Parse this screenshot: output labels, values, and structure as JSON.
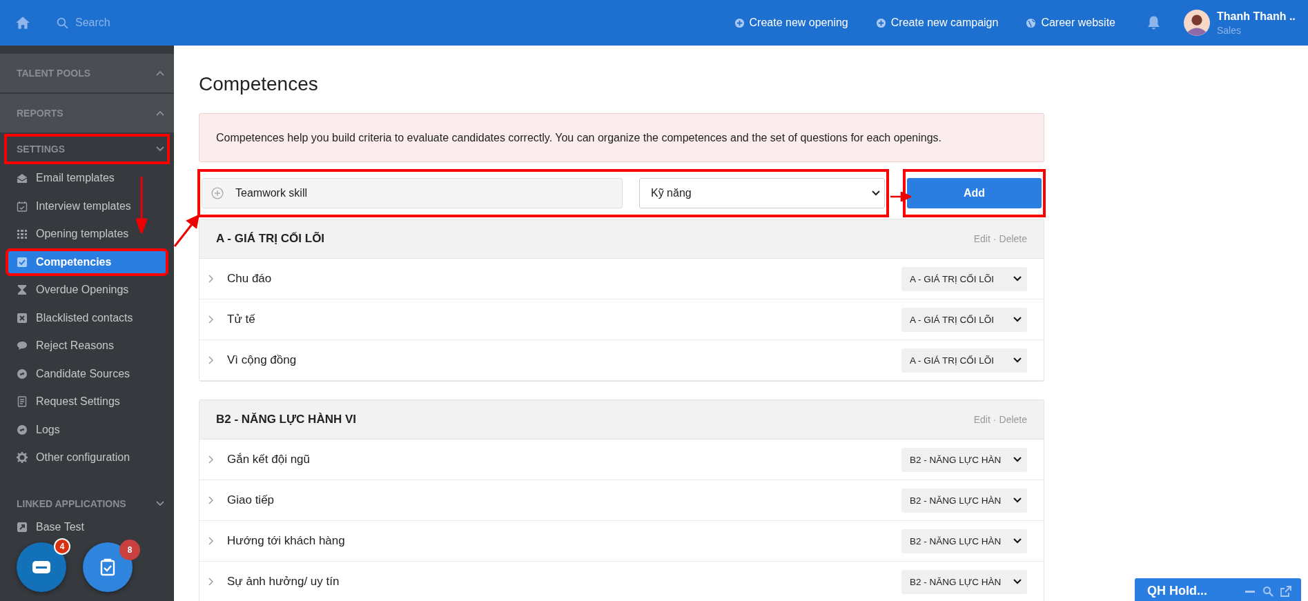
{
  "topbar": {
    "search_placeholder": "Search",
    "actions": [
      "Create new opening",
      "Create new campaign",
      "Career website"
    ],
    "user": {
      "name": "Thanh Thanh ..",
      "role": "Sales"
    }
  },
  "sidebar": {
    "sections": [
      {
        "title": "TALENT POOLS",
        "expanded": false,
        "highlighted": false
      },
      {
        "title": "REPORTS",
        "expanded": false,
        "highlighted": false
      },
      {
        "title": "SETTINGS",
        "expanded": true,
        "highlighted": true,
        "items": [
          {
            "label": "Email templates",
            "selected": false,
            "highlighted": false
          },
          {
            "label": "Interview templates",
            "selected": false,
            "highlighted": false
          },
          {
            "label": "Opening templates",
            "selected": false,
            "highlighted": false
          },
          {
            "label": "Competencies",
            "selected": true,
            "highlighted": true
          },
          {
            "label": "Overdue Openings",
            "selected": false,
            "highlighted": false
          },
          {
            "label": "Blacklisted contacts",
            "selected": false,
            "highlighted": false
          },
          {
            "label": "Reject Reasons",
            "selected": false,
            "highlighted": false
          },
          {
            "label": "Candidate Sources",
            "selected": false,
            "highlighted": false
          },
          {
            "label": "Request Settings",
            "selected": false,
            "highlighted": false
          },
          {
            "label": "Logs",
            "selected": false,
            "highlighted": false
          },
          {
            "label": "Other configuration",
            "selected": false,
            "highlighted": false
          }
        ]
      },
      {
        "title": "LINKED APPLICATIONS",
        "expanded": true,
        "highlighted": false,
        "items": [
          {
            "label": "Base Test",
            "selected": false,
            "highlighted": false
          }
        ]
      }
    ]
  },
  "page": {
    "title": "Competences",
    "notice": "Competences help you build criteria to evaluate candidates correctly. You can organize the competences and the set of questions for each openings.",
    "form": {
      "value": "Teamwork skill",
      "category": "Kỹ năng",
      "highlighted": true,
      "add_label": "Add",
      "add_highlighted": true
    },
    "groups": [
      {
        "title": "A - GIÁ TRỊ CỐI LÕI",
        "edit": "Edit",
        "separator": "·",
        "delete": "Delete",
        "items": [
          {
            "name": "Chu đáo",
            "category": "A - GIÁ TRỊ CỐI LÕI"
          },
          {
            "name": "Tử tế",
            "category": "A - GIÁ TRỊ CỐI LÕI"
          },
          {
            "name": "Vì cộng đồng",
            "category": "A - GIÁ TRỊ CỐI LÕI"
          }
        ]
      },
      {
        "title": "B2 - NĂNG LỰC HÀNH VI",
        "edit": "Edit",
        "separator": "·",
        "delete": "Delete",
        "items": [
          {
            "name": "Gắn kết đội ngũ",
            "category": "B2 - NĂNG LỰC HÀN"
          },
          {
            "name": "Giao tiếp",
            "category": "B2 - NĂNG LỰC HÀN"
          },
          {
            "name": "Hướng tới khách hàng",
            "category": "B2 - NĂNG LỰC HÀN"
          },
          {
            "name": "Sự ảnh hưởng/ uy tín",
            "category": "B2 - NĂNG LỰC HÀN"
          }
        ]
      }
    ]
  },
  "floating": {
    "chat_badge": "4",
    "tasks_badge": "8"
  },
  "chat_widget": {
    "title": "QH Hold..."
  }
}
